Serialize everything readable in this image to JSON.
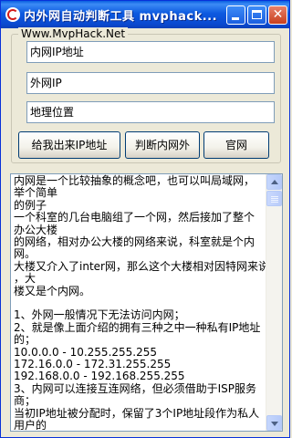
{
  "window": {
    "title": "内外网自动判断工具 mvphack...",
    "minimize_icon": "minimize-icon",
    "maximize_icon": "maximize-icon",
    "close_icon": "close-icon",
    "close_glyph": "✕"
  },
  "group": {
    "legend": "Www.MvpHack.Net"
  },
  "fields": {
    "internal_ip": "内网IP地址",
    "external_ip": "外网IP",
    "location": "地理位置"
  },
  "buttons": {
    "show_ip": "给我出来IP地址",
    "detect": "判断内网外",
    "official": "官网"
  },
  "info_text": [
    "内网是一个比较抽象的概念吧，也可以叫局域网，",
    "举个简单",
    "的例子",
    "一个科室的几台电脑组了一个网，然后接加了整个",
    "办公大楼",
    "的网络，相对办公大楼的网络来说，科室就是个内",
    "网。",
    "大楼又介入了inter网，那么这个大楼相对因特网来说",
    "，大",
    "楼又是个内网。",
    "",
    "1、外网一般情况下无法访问内网；",
    "2、就是像上面介绍的拥有三种之中一种私有IP地址",
    "的；",
    "10.0.0.0 - 10.255.255.255",
    "172.16.0.0 - 172.31.255.255",
    "192.168.0.0 - 192.168.255.255",
    "3、内网可以连接互连网络，但必须借助于ISP服务",
    "商；",
    "当初IP地址被分配时，保留了3个IP地址段作为私人",
    "用户的"
  ]
}
